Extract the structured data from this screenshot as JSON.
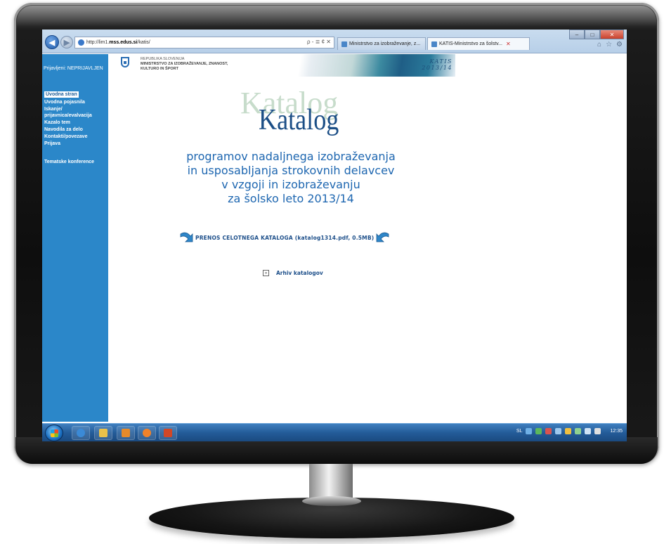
{
  "browser": {
    "address": {
      "prefix": "http://lim1.",
      "host": "mss.edus.si",
      "path": "/katis/"
    },
    "address_tools": "ρ - ≣ ¢ ✕",
    "tabs": [
      {
        "label": "Ministrstvo za izobraževanje, z...",
        "active": false
      },
      {
        "label": "KATIS-Ministrstvo za šolstv...",
        "active": true
      }
    ],
    "tab_close": "✕",
    "window_buttons": {
      "minimize": "–",
      "maximize": "□",
      "close": "✕"
    },
    "toolbar_icons": [
      "⌂",
      "☆",
      "⚙"
    ]
  },
  "sidebar": {
    "user_label": "Prijavljeni: NEPRIJAVLJEN",
    "menu": [
      {
        "label": "Uvodna stran",
        "active": true
      },
      {
        "label": "Uvodna pojasnila",
        "active": false
      },
      {
        "label": "Iskanje/ prijavnica/evalvacija",
        "active": false
      },
      {
        "label": "Kazalo tem",
        "active": false
      },
      {
        "label": "Navodila za delo",
        "active": false
      },
      {
        "label": "Kontakti/povezave",
        "active": false
      },
      {
        "label": "Prijava",
        "active": false
      }
    ],
    "extra": "Tematske konference"
  },
  "header": {
    "line1": "REPUBLIKA SLOVENIJA",
    "line2": "MINISTRSTVO ZA IZOBRAŽEVANJE, ZNANOST,",
    "line3": "KULTURO IN ŠPORT",
    "app_name": "KATIS",
    "school_year": "2013/14"
  },
  "main": {
    "logo_shadow": "Katalog",
    "logo": "Katalog",
    "subtitle_lines": [
      "programov nadaljnega izobraževanja",
      "in usposabljanja strokovnih delavcev",
      "v vzgoji in izobraževanju",
      "za šolsko leto 2013/14"
    ],
    "download_link": "PRENOS CELOTNEGA KATALOGA (katalog1314.pdf, 0.5MB)",
    "archive_link": "Arhiv katalogov",
    "archive_icon_glyph": "»"
  },
  "taskbar": {
    "language": "SL",
    "clock": "12:35"
  },
  "colors": {
    "sidebar_bg": "#2b87c9",
    "link_blue": "#1d4f8a",
    "subtitle_blue": "#1d66b0",
    "taskbar": "#245c99"
  }
}
